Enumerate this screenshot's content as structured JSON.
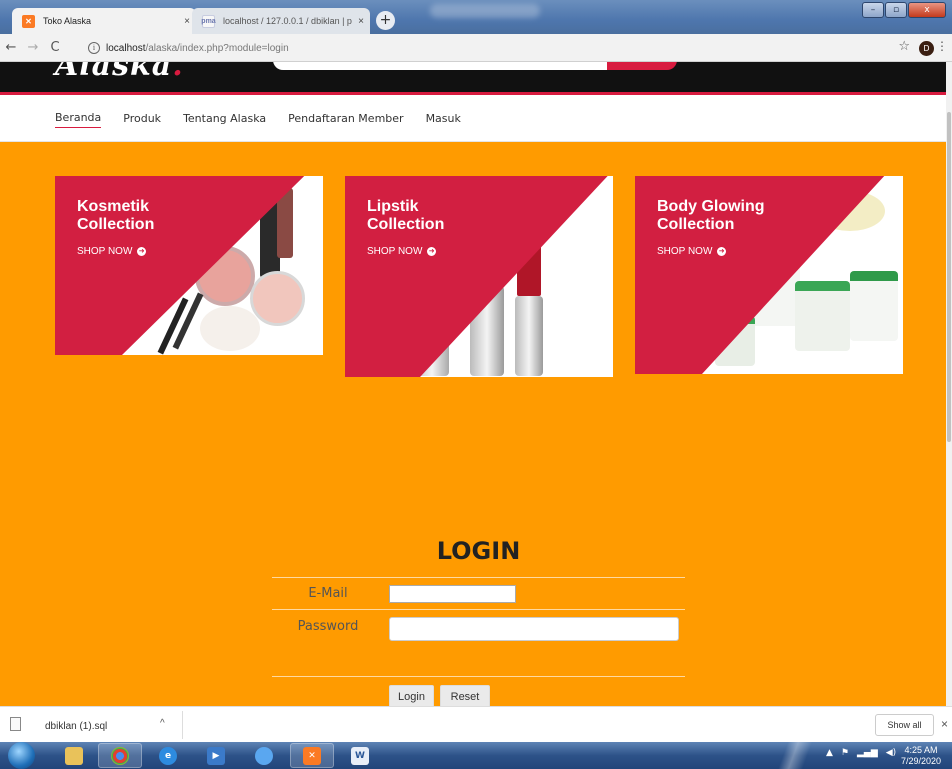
{
  "browser": {
    "tabs": [
      {
        "title": "Toko Alaska",
        "close": "×"
      },
      {
        "title": "localhost / 127.0.0.1 / dbiklan | p",
        "close": "×"
      }
    ],
    "new_tab": "+",
    "url_host": "localhost",
    "url_path": "/alaska/index.php?module=login",
    "profile_initial": "D",
    "window_buttons": {
      "minimize": "–",
      "maximize": "▫",
      "close": "x"
    }
  },
  "site": {
    "logo_fragment": "Alaska",
    "nav": [
      {
        "label": "Beranda",
        "active": true
      },
      {
        "label": "Produk",
        "active": false
      },
      {
        "label": "Tentang Alaska",
        "active": false
      },
      {
        "label": "Pendaftaran Member",
        "active": false
      },
      {
        "label": "Masuk",
        "active": false
      }
    ],
    "banners": [
      {
        "title_line1": "Kosmetik",
        "title_line2": "Collection",
        "cta": "SHOP NOW"
      },
      {
        "title_line1": "Lipstik",
        "title_line2": "Collection",
        "cta": "SHOP NOW"
      },
      {
        "title_line1": "Body Glowing",
        "title_line2": "Collection",
        "cta": "SHOP NOW"
      }
    ],
    "login": {
      "title": "LOGIN",
      "email_label": "E-Mail",
      "password_label": "Password",
      "login_button": "Login",
      "reset_button": "Reset"
    }
  },
  "downloads": {
    "file_name": "dbiklan (1).sql",
    "show_all": "Show all",
    "close": "×"
  },
  "taskbar": {
    "time": "4:25 AM",
    "date": "7/29/2020"
  },
  "colors": {
    "brand_red": "#d21f41",
    "page_orange": "#ff9b00"
  }
}
